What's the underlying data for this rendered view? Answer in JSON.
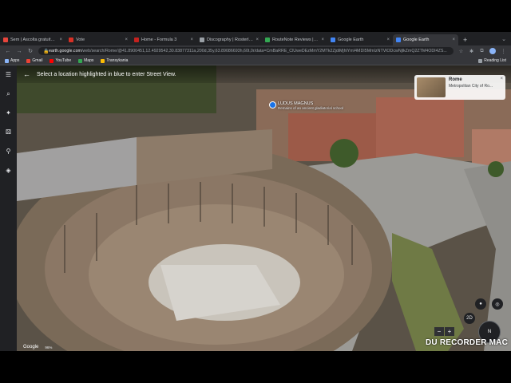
{
  "tabs": [
    {
      "label": "Sem | Ascolta gratuitament",
      "favicon_color": "#e8453c",
      "active": false
    },
    {
      "label": "Vote",
      "favicon_color": "#d93025",
      "active": false
    },
    {
      "label": "Home - Formula 3",
      "favicon_color": "#c5221f",
      "active": false
    },
    {
      "label": "Discography | Rosterleim",
      "favicon_color": "#9aa0a6",
      "active": false
    },
    {
      "label": "RouteNote Reviews | Read",
      "favicon_color": "#34a853",
      "active": false
    },
    {
      "label": "Google Earth",
      "favicon_color": "#4285f4",
      "active": false
    },
    {
      "label": "Google Earth",
      "favicon_color": "#4285f4",
      "active": true
    }
  ],
  "omnibox": {
    "host": "earth.google.com",
    "path": "/web/search/Rome/@41.8900451,12.4929542,30.83877311a,200d,35y,63.89086693h,60t,0r/data=CmBaRRE_ClUweDEzMmY2MTk2ZjdiMjhlYmI4MDI5MmIzNTVlODcwNjlkZmQ2ZTM4ODI4ZS..."
  },
  "bookmarks": [
    "Apps",
    "Gmail",
    "YouTube",
    "Maps",
    "Transykania"
  ],
  "reading_list": "Reading List",
  "banner": {
    "text": "Select a location highlighted in blue to enter Street View."
  },
  "place_card": {
    "title": "Rome",
    "subtitle": "Metropolitan City of Ro..."
  },
  "poi": {
    "title": "LUDUS MAGNUS",
    "subtitle": "Remains of an ancient gladiatorial school"
  },
  "map_controls": {
    "view_mode": "2D",
    "zoom_in": "+",
    "zoom_out": "−"
  },
  "footer": {
    "logo": "Google",
    "scale": "96%"
  },
  "watermark": "DU RECORDER MAC",
  "colors": {
    "accent": "#1a73e8",
    "chrome_dark": "#202124",
    "chrome_mid": "#35363a"
  }
}
